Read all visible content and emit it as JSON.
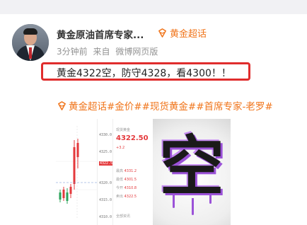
{
  "user": {
    "name": "黄金原油首席专家...",
    "badge": "黄金超话"
  },
  "meta": {
    "time": "3分钟前",
    "source_prefix": "来自",
    "source": "微博网页版"
  },
  "post": {
    "text": "黄金4322空，防守4328，看4300！！"
  },
  "hashtags": "黄金超话#金价##现货黄金##首席专家-老罗#",
  "colors": {
    "accent_orange": "#f0741a",
    "highlight_red": "#e02d2d"
  },
  "thumb1": {
    "prices": [
      "4330.0",
      "4325.0",
      "4322.50",
      "4320.0",
      "4315.0",
      "4310.0"
    ],
    "title": "现货黄金",
    "price": "4322.50",
    "change": "+3.2",
    "rows": [
      {
        "k": "最高",
        "v": "4331.2"
      },
      {
        "k": "最低",
        "v": "4301.5"
      },
      {
        "k": "今开",
        "v": "4310.8"
      },
      {
        "k": "卖出",
        "v": "4322.5"
      }
    ],
    "footer": "全部资讯"
  },
  "thumb2": {
    "char": "空"
  }
}
